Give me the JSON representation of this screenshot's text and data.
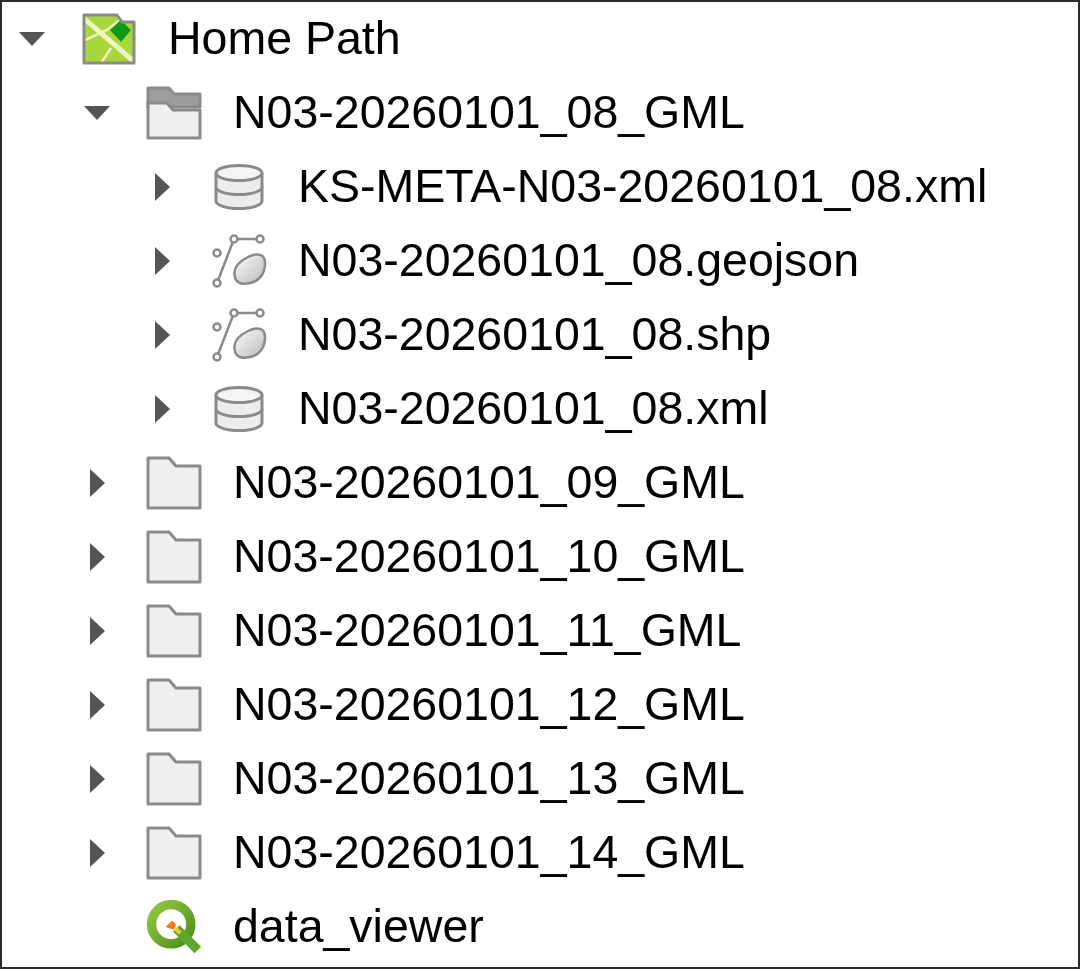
{
  "tree": [
    {
      "label": "Home Path",
      "kind": "home",
      "expanded": true,
      "children": [
        {
          "label": "N03-20260101_08_GML",
          "kind": "folder",
          "expanded": true,
          "children": [
            {
              "label": "KS-META-N03-20260101_08.xml",
              "kind": "database",
              "expanded": false
            },
            {
              "label": "N03-20260101_08.geojson",
              "kind": "vector",
              "expanded": false
            },
            {
              "label": "N03-20260101_08.shp",
              "kind": "vector",
              "expanded": false
            },
            {
              "label": "N03-20260101_08.xml",
              "kind": "database",
              "expanded": false
            }
          ]
        },
        {
          "label": "N03-20260101_09_GML",
          "kind": "folder",
          "expanded": false
        },
        {
          "label": "N03-20260101_10_GML",
          "kind": "folder",
          "expanded": false
        },
        {
          "label": "N03-20260101_11_GML",
          "kind": "folder",
          "expanded": false
        },
        {
          "label": "N03-20260101_12_GML",
          "kind": "folder",
          "expanded": false
        },
        {
          "label": "N03-20260101_13_GML",
          "kind": "folder",
          "expanded": false
        },
        {
          "label": "N03-20260101_14_GML",
          "kind": "folder",
          "expanded": false
        },
        {
          "label": "data_viewer",
          "kind": "project"
        }
      ]
    }
  ]
}
